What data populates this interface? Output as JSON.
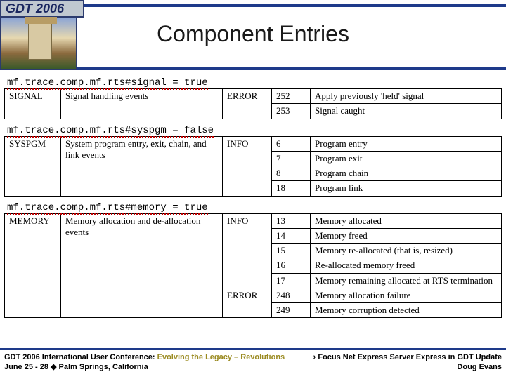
{
  "badge": {
    "text": "GDT 2006"
  },
  "title": "Component Entries",
  "sections": [
    {
      "config": "mf.trace.comp.mf.rts#signal = true",
      "rows": [
        {
          "name": "SIGNAL",
          "desc": "Signal handling events",
          "level": "ERROR",
          "code": "252",
          "note": "Apply previously 'held' signal"
        },
        {
          "name": "",
          "desc": "",
          "level": "",
          "code": "253",
          "note": "Signal caught"
        }
      ]
    },
    {
      "config": "mf.trace.comp.mf.rts#syspgm = false",
      "rows": [
        {
          "name": "SYSPGM",
          "desc": "System program entry, exit, chain, and link events",
          "level": "INFO",
          "code": "6",
          "note": "Program entry"
        },
        {
          "name": "",
          "desc": "",
          "level": "",
          "code": "7",
          "note": "Program exit"
        },
        {
          "name": "",
          "desc": "",
          "level": "",
          "code": "8",
          "note": "Program chain"
        },
        {
          "name": "",
          "desc": "",
          "level": "",
          "code": "18",
          "note": "Program link"
        }
      ]
    },
    {
      "config": "mf.trace.comp.mf.rts#memory = true",
      "rows": [
        {
          "name": "MEMORY",
          "desc": "Memory allocation and de-allocation events",
          "level": "INFO",
          "code": "13",
          "note": "Memory allocated"
        },
        {
          "name": "",
          "desc": "",
          "level": "",
          "code": "14",
          "note": "Memory freed"
        },
        {
          "name": "",
          "desc": "",
          "level": "",
          "code": "15",
          "note": "Memory re-allocated (that is, resized)"
        },
        {
          "name": "",
          "desc": "",
          "level": "",
          "code": "16",
          "note": "Re-allocated memory freed"
        },
        {
          "name": "",
          "desc": "",
          "level": "",
          "code": "17",
          "note": "Memory remaining allocated at RTS termination"
        },
        {
          "name": "",
          "desc": "",
          "level": "ERROR",
          "code": "248",
          "note": "Memory allocation failure"
        },
        {
          "name": "",
          "desc": "",
          "level": "",
          "code": "249",
          "note": "Memory corruption detected"
        }
      ]
    }
  ],
  "footer": {
    "conf_line1a": "GDT 2006 International User Conference: ",
    "conf_line1b": "Evolving the Legacy – Revolutions",
    "conf_line2": "June 25 - 28  ◆  Palm Springs, California",
    "right1": "› Focus Net Express Server Express in GDT Update",
    "right2": "Doug Evans"
  }
}
